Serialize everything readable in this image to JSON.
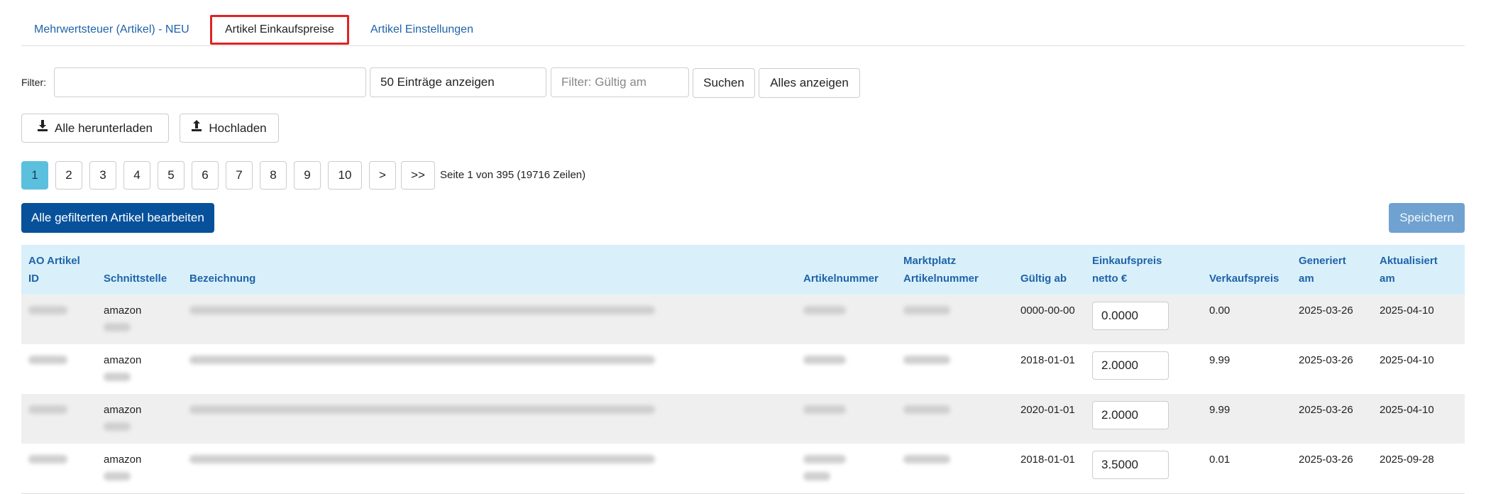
{
  "tabs": [
    {
      "label": "Mehrwertsteuer (Artikel) - NEU",
      "active": false
    },
    {
      "label": "Artikel Einkaufspreise",
      "active": true
    },
    {
      "label": "Artikel Einstellungen",
      "active": false
    }
  ],
  "filter": {
    "label": "Filter:",
    "text_value": "",
    "entries_select": "50 Einträge anzeigen",
    "valid_placeholder": "Filter: Gültig am",
    "search_button": "Suchen",
    "show_all_button": "Alles anzeigen"
  },
  "actions": {
    "download_all": "Alle herunterladen",
    "upload": "Hochladen",
    "edit_filtered": "Alle gefilterten Artikel bearbeiten",
    "save": "Speichern"
  },
  "pagination": {
    "pages": [
      "1",
      "2",
      "3",
      "4",
      "5",
      "6",
      "7",
      "8",
      "9",
      "10",
      ">",
      ">>"
    ],
    "current": "1",
    "info": "Seite 1 von 395 (19716 Zeilen)"
  },
  "table": {
    "headers": {
      "ao_id": [
        "AO Artikel",
        "ID"
      ],
      "interface": "Schnittstelle",
      "name": "Bezeichnung",
      "article_no": "Artikelnummer",
      "marketplace_no": [
        "Marktplatz",
        "Artikelnummer"
      ],
      "valid_from": "Gültig ab",
      "purchase_price": [
        "Einkaufspreis",
        "netto €"
      ],
      "sale_price": "Verkaufspreis",
      "generated": [
        "Generiert",
        "am"
      ],
      "updated": [
        "Aktualisiert",
        "am"
      ]
    },
    "rows": [
      {
        "interface": "amazon",
        "valid_from": "0000-00-00",
        "purchase_price": "0.0000",
        "sale_price": "0.00",
        "generated": "2025-03-26",
        "updated": "2025-04-10"
      },
      {
        "interface": "amazon",
        "valid_from": "2018-01-01",
        "purchase_price": "2.0000",
        "sale_price": "9.99",
        "generated": "2025-03-26",
        "updated": "2025-04-10"
      },
      {
        "interface": "amazon",
        "valid_from": "2020-01-01",
        "purchase_price": "2.0000",
        "sale_price": "9.99",
        "generated": "2025-03-26",
        "updated": "2025-04-10"
      },
      {
        "interface": "amazon",
        "valid_from": "2018-01-01",
        "purchase_price": "3.5000",
        "sale_price": "0.01",
        "generated": "2025-03-26",
        "updated": "2025-09-28"
      }
    ]
  },
  "colors": {
    "link": "#1f63a8",
    "active_tab_border": "#e02323",
    "primary": "#07519b",
    "save_button": "#6fa2d0",
    "page_active": "#5bc0de",
    "table_header_bg": "#d9f0fb"
  },
  "icons": {
    "download": "download-icon",
    "upload": "upload-icon"
  }
}
